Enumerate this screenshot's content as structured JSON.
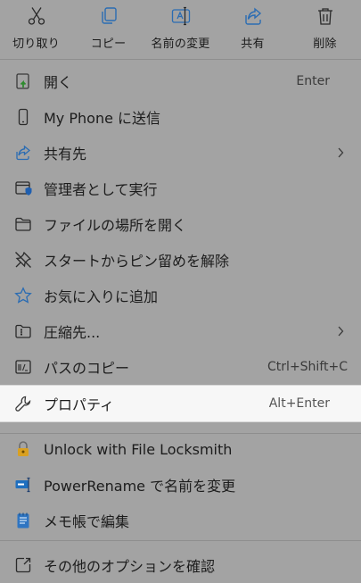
{
  "actions": [
    {
      "label": "切り取り",
      "icon": "scissors-icon"
    },
    {
      "label": "コピー",
      "icon": "copy-icon"
    },
    {
      "label": "名前の変更",
      "icon": "rename-icon"
    },
    {
      "label": "共有",
      "icon": "share-icon"
    },
    {
      "label": "削除",
      "icon": "trash-icon"
    }
  ],
  "items": [
    {
      "label": "開く",
      "shortcut": "Enter",
      "icon": "open-icon"
    },
    {
      "label": "My Phone に送信",
      "shortcut": "",
      "icon": "phone-icon"
    },
    {
      "label": "共有先",
      "shortcut": "",
      "icon": "share-icon",
      "submenu": true
    },
    {
      "label": "管理者として実行",
      "shortcut": "",
      "icon": "admin-shield-icon"
    },
    {
      "label": "ファイルの場所を開く",
      "shortcut": "",
      "icon": "folder-icon"
    },
    {
      "label": "スタートからピン留めを解除",
      "shortcut": "",
      "icon": "unpin-icon"
    },
    {
      "label": "お気に入りに追加",
      "shortcut": "",
      "icon": "star-icon"
    },
    {
      "label": "圧縮先...",
      "shortcut": "",
      "icon": "zip-folder-icon",
      "submenu": true
    },
    {
      "label": "パスのコピー",
      "shortcut": "Ctrl+Shift+C",
      "icon": "copy-path-icon"
    },
    {
      "label": "プロパティ",
      "shortcut": "Alt+Enter",
      "icon": "wrench-icon",
      "highlighted": true
    },
    {
      "label": "Unlock with File Locksmith",
      "shortcut": "",
      "icon": "lock-icon"
    },
    {
      "label": "PowerRename で名前を変更",
      "shortcut": "",
      "icon": "powerrename-icon"
    },
    {
      "label": "メモ帳で編集",
      "shortcut": "",
      "icon": "notepad-icon"
    },
    {
      "label": "その他のオプションを確認",
      "shortcut": "",
      "icon": "more-options-icon"
    }
  ],
  "colors": {
    "overlay": "#a3a3a3",
    "highlight": "#f7f7f7",
    "accent": "#0067c0"
  }
}
